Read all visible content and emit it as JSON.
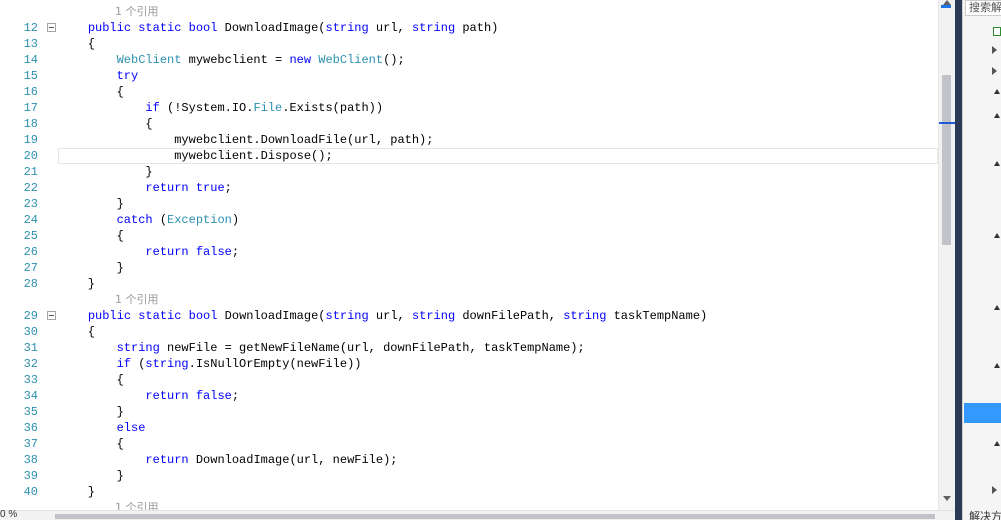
{
  "editor": {
    "lines": [
      {
        "n": "12",
        "fold": true,
        "tokens": [
          [
            "",
            "    "
          ],
          [
            "kw",
            "public"
          ],
          [
            "",
            " "
          ],
          [
            "kw",
            "static"
          ],
          [
            "",
            " "
          ],
          [
            "kw",
            "bool"
          ],
          [
            "",
            " DownloadImage("
          ],
          [
            "kw",
            "string"
          ],
          [
            "",
            " url, "
          ],
          [
            "kw",
            "string"
          ],
          [
            "",
            " path)"
          ]
        ]
      },
      {
        "n": "13",
        "tokens": [
          [
            "",
            "    {"
          ]
        ]
      },
      {
        "n": "14",
        "tokens": [
          [
            "",
            "        "
          ],
          [
            "ty",
            "WebClient"
          ],
          [
            "",
            " mywebclient = "
          ],
          [
            "kw",
            "new"
          ],
          [
            "",
            " "
          ],
          [
            "ty",
            "WebClient"
          ],
          [
            "",
            "();"
          ]
        ]
      },
      {
        "n": "15",
        "tokens": [
          [
            "",
            "        "
          ],
          [
            "kw",
            "try"
          ]
        ]
      },
      {
        "n": "16",
        "tokens": [
          [
            "",
            "        {"
          ]
        ]
      },
      {
        "n": "17",
        "tokens": [
          [
            "",
            "            "
          ],
          [
            "kw",
            "if"
          ],
          [
            "",
            " (!System.IO."
          ],
          [
            "ty",
            "File"
          ],
          [
            "",
            ".Exists(path))"
          ]
        ]
      },
      {
        "n": "18",
        "tokens": [
          [
            "",
            "            {"
          ]
        ]
      },
      {
        "n": "19",
        "tokens": [
          [
            "",
            "                mywebclient.DownloadFile(url, path);"
          ]
        ]
      },
      {
        "n": "20",
        "tokens": [
          [
            "",
            "                mywebclient.Dispose();"
          ]
        ]
      },
      {
        "n": "21",
        "tokens": [
          [
            "",
            "            }"
          ]
        ]
      },
      {
        "n": "22",
        "tokens": [
          [
            "",
            "            "
          ],
          [
            "kw",
            "return"
          ],
          [
            "",
            " "
          ],
          [
            "kw",
            "true"
          ],
          [
            "",
            ";"
          ]
        ]
      },
      {
        "n": "23",
        "tokens": [
          [
            "",
            "        }"
          ]
        ]
      },
      {
        "n": "24",
        "tokens": [
          [
            "",
            "        "
          ],
          [
            "kw",
            "catch"
          ],
          [
            "",
            " ("
          ],
          [
            "ty",
            "Exception"
          ],
          [
            "",
            ")"
          ]
        ]
      },
      {
        "n": "25",
        "tokens": [
          [
            "",
            "        {"
          ]
        ]
      },
      {
        "n": "26",
        "tokens": [
          [
            "",
            "            "
          ],
          [
            "kw",
            "return"
          ],
          [
            "",
            " "
          ],
          [
            "kw",
            "false"
          ],
          [
            "",
            ";"
          ]
        ]
      },
      {
        "n": "27",
        "tokens": [
          [
            "",
            "        }"
          ]
        ]
      },
      {
        "n": "28",
        "tokens": [
          [
            "",
            "    }"
          ]
        ]
      },
      {
        "n": "",
        "ref": "1 个引用"
      },
      {
        "n": "29",
        "fold": true,
        "tokens": [
          [
            "",
            "    "
          ],
          [
            "kw",
            "public"
          ],
          [
            "",
            " "
          ],
          [
            "kw",
            "static"
          ],
          [
            "",
            " "
          ],
          [
            "kw",
            "bool"
          ],
          [
            "",
            " DownloadImage("
          ],
          [
            "kw",
            "string"
          ],
          [
            "",
            " url, "
          ],
          [
            "kw",
            "string"
          ],
          [
            "",
            " downFilePath, "
          ],
          [
            "kw",
            "string"
          ],
          [
            "",
            " taskTempName)"
          ]
        ]
      },
      {
        "n": "30",
        "tokens": [
          [
            "",
            "    {"
          ]
        ]
      },
      {
        "n": "31",
        "tokens": [
          [
            "",
            "        "
          ],
          [
            "kw",
            "string"
          ],
          [
            "",
            " newFile = getNewFileName(url, downFilePath, taskTempName);"
          ]
        ]
      },
      {
        "n": "32",
        "tokens": [
          [
            "",
            "        "
          ],
          [
            "kw",
            "if"
          ],
          [
            "",
            " ("
          ],
          [
            "kw",
            "string"
          ],
          [
            "",
            ".IsNullOrEmpty(newFile))"
          ]
        ]
      },
      {
        "n": "33",
        "tokens": [
          [
            "",
            "        {"
          ]
        ]
      },
      {
        "n": "34",
        "tokens": [
          [
            "",
            "            "
          ],
          [
            "kw",
            "return"
          ],
          [
            "",
            " "
          ],
          [
            "kw",
            "false"
          ],
          [
            "",
            ";"
          ]
        ]
      },
      {
        "n": "35",
        "tokens": [
          [
            "",
            "        }"
          ]
        ]
      },
      {
        "n": "36",
        "tokens": [
          [
            "",
            "        "
          ],
          [
            "kw",
            "else"
          ]
        ]
      },
      {
        "n": "37",
        "tokens": [
          [
            "",
            "        {"
          ]
        ]
      },
      {
        "n": "38",
        "tokens": [
          [
            "",
            "            "
          ],
          [
            "kw",
            "return"
          ],
          [
            "",
            " DownloadImage(url, newFile);"
          ]
        ]
      },
      {
        "n": "39",
        "tokens": [
          [
            "",
            "        }"
          ]
        ]
      },
      {
        "n": "40",
        "tokens": [
          [
            "",
            "    }"
          ]
        ]
      },
      {
        "n": "",
        "ref": "1 个引用"
      }
    ],
    "top_ref": "1 个引用",
    "zoom": "0 %"
  },
  "right_panel": {
    "search_placeholder": "搜索解",
    "footer": "解决方"
  },
  "colors": {
    "keyword": "#0000ff",
    "type": "#2b91af",
    "line_number": "#2b91af",
    "reference_hint": "#9a9a9a",
    "selection": "#3399ff"
  }
}
